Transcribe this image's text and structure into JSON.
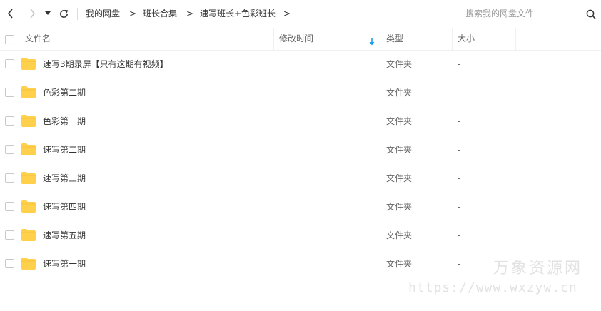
{
  "nav": {
    "back_icon": "chevron-left-icon",
    "forward_icon": "chevron-right-icon",
    "history_icon": "caret-down-icon",
    "refresh_icon": "refresh-icon"
  },
  "breadcrumb": {
    "items": [
      "我的网盘",
      "班长合集",
      "速写班长+色彩班长"
    ],
    "separator": ">"
  },
  "search": {
    "placeholder": "搜索我的网盘文件",
    "value": "",
    "icon": "search-icon"
  },
  "columns": {
    "name": "文件名",
    "modified": "修改时间",
    "type": "类型",
    "size": "大小",
    "sort_icon": "arrow-down-icon",
    "sort_color": "#1e9fe6"
  },
  "files": [
    {
      "name": "速写3期录屏【只有这期有视频】",
      "type": "文件夹",
      "size": "-"
    },
    {
      "name": "色彩第二期",
      "type": "文件夹",
      "size": "-"
    },
    {
      "name": "色彩第一期",
      "type": "文件夹",
      "size": "-"
    },
    {
      "name": "速写第二期",
      "type": "文件夹",
      "size": "-"
    },
    {
      "name": "速写第三期",
      "type": "文件夹",
      "size": "-"
    },
    {
      "name": "速写第四期",
      "type": "文件夹",
      "size": "-"
    },
    {
      "name": "速写第五期",
      "type": "文件夹",
      "size": "-"
    },
    {
      "name": "速写第一期",
      "type": "文件夹",
      "size": "-"
    }
  ],
  "folder_color": "#ffd04b",
  "watermark": {
    "title": "万象资源网",
    "url": "https://www.wxzyw.cn"
  }
}
